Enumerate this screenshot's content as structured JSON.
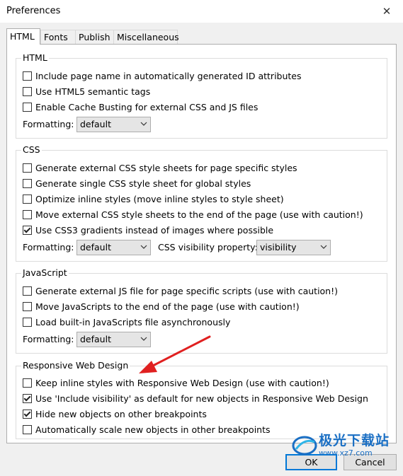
{
  "window": {
    "title": "Preferences"
  },
  "tabs": [
    "HTML",
    "Fonts",
    "Publish",
    "Miscellaneous"
  ],
  "html_group": {
    "legend": "HTML",
    "options": [
      {
        "label": "Include page name in automatically generated ID attributes",
        "checked": false
      },
      {
        "label": "Use HTML5 semantic tags",
        "checked": false
      },
      {
        "label": "Enable Cache Busting for external CSS and JS files",
        "checked": false
      }
    ],
    "formatting_label": "Formatting:",
    "formatting_value": "default"
  },
  "css_group": {
    "legend": "CSS",
    "options": [
      {
        "label": "Generate external CSS style sheets for page specific styles",
        "checked": false
      },
      {
        "label": "Generate single CSS style sheet for global styles",
        "checked": false
      },
      {
        "label": "Optimize inline styles (move inline styles to style sheet)",
        "checked": false
      },
      {
        "label": "Move external CSS style sheets to the end of the page (use with caution!)",
        "checked": false
      },
      {
        "label": "Use CSS3 gradients instead of images where possible",
        "checked": true
      }
    ],
    "formatting_label": "Formatting:",
    "formatting_value": "default",
    "visibility_label": "CSS visibility property:",
    "visibility_value": "visibility"
  },
  "js_group": {
    "legend": "JavaScript",
    "options": [
      {
        "label": "Generate external JS file for page specific scripts (use with caution!)",
        "checked": false
      },
      {
        "label": "Move JavaScripts to the end of the page (use with caution!)",
        "checked": false
      },
      {
        "label": "Load built-in JavaScripts file asynchronously",
        "checked": false
      }
    ],
    "formatting_label": "Formatting:",
    "formatting_value": "default"
  },
  "rwd_group": {
    "legend": "Responsive Web Design",
    "options": [
      {
        "label": "Keep inline styles with Responsive Web Design (use with caution!)",
        "checked": false
      },
      {
        "label": "Use 'Include visibility' as default for new objects in Responsive Web Design",
        "checked": true
      },
      {
        "label": "Hide new objects on other breakpoints",
        "checked": true
      },
      {
        "label": "Automatically scale new objects in other breakpoints",
        "checked": false
      }
    ]
  },
  "buttons": {
    "ok": "OK",
    "cancel": "Cancel"
  },
  "watermark": {
    "text": "极光下载站",
    "url": "www.xz7.com"
  },
  "colors": {
    "accent": "#0078d7",
    "annotation_arrow": "#e02020",
    "watermark": "#1a6fc4"
  }
}
